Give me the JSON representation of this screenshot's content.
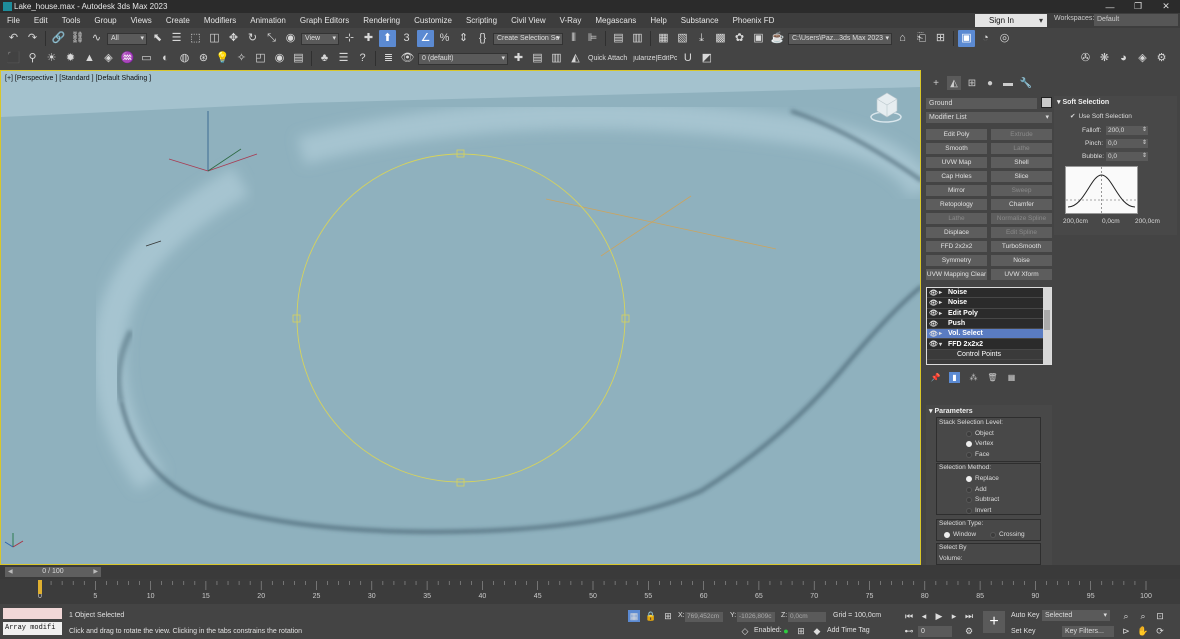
{
  "window": {
    "title": "Lake_house.max - Autodesk 3ds Max 2023",
    "controls": [
      "—",
      "❐",
      "✕"
    ]
  },
  "menubar": {
    "items": [
      "File",
      "Edit",
      "Tools",
      "Group",
      "Views",
      "Create",
      "Modifiers",
      "Animation",
      "Graph Editors",
      "Rendering",
      "Customize",
      "Scripting",
      "Civil View",
      "V-Ray",
      "Megascans",
      "Help",
      "Substance",
      "Phoenix FD"
    ],
    "sign_in": "Sign In",
    "workspaces_label": "Workspaces:",
    "workspaces_value": "Default"
  },
  "toolbar1": {
    "filter": "All",
    "ref_coord": "View",
    "selection_set": "Create Selection Se",
    "project_path": "C:\\Users\\Paz...3ds Max 2023"
  },
  "toolbar2": {
    "layer": "0 (default)",
    "quick_attach": "Quick Attach",
    "regularize": "jularize|EditPo"
  },
  "viewport": {
    "label": "[+] [Perspective ] [Standard ] [Default Shading ]",
    "ground_color": "#8fb1be",
    "gizmo_color": "#d6d35c"
  },
  "command_panel": {
    "object_name": "Ground",
    "modifier_list": "Modifier List",
    "modifier_buttons": [
      {
        "label": "Edit Poly",
        "enabled": true
      },
      {
        "label": "Extrude",
        "enabled": false
      },
      {
        "label": "Smooth",
        "enabled": true
      },
      {
        "label": "Lathe",
        "enabled": false
      },
      {
        "label": "UVW Map",
        "enabled": true
      },
      {
        "label": "Shell",
        "enabled": true
      },
      {
        "label": "Cap Holes",
        "enabled": true
      },
      {
        "label": "Slice",
        "enabled": true
      },
      {
        "label": "Mirror",
        "enabled": true
      },
      {
        "label": "Sweep",
        "enabled": false
      },
      {
        "label": "Retopology",
        "enabled": true
      },
      {
        "label": "Chamfer",
        "enabled": true
      },
      {
        "label": "Lathe",
        "enabled": false
      },
      {
        "label": "Normalize Spline",
        "enabled": false
      },
      {
        "label": "Displace",
        "enabled": true
      },
      {
        "label": "Edit Spline",
        "enabled": false
      },
      {
        "label": "FFD 2x2x2",
        "enabled": true
      },
      {
        "label": "TurboSmooth",
        "enabled": true
      },
      {
        "label": "Symmetry",
        "enabled": true
      },
      {
        "label": "Noise",
        "enabled": true
      },
      {
        "label": "UVW Mapping Clear",
        "enabled": true
      },
      {
        "label": "UVW Xform",
        "enabled": true
      }
    ],
    "stack": [
      {
        "label": "Noise",
        "selected": false
      },
      {
        "label": "Noise",
        "selected": false
      },
      {
        "label": "Edit Poly",
        "selected": false
      },
      {
        "label": "Push",
        "selected": false
      },
      {
        "label": "Vol. Select",
        "selected": true
      },
      {
        "label": "FFD 2x2x2",
        "selected": false,
        "expanded": true
      }
    ],
    "stack_sub": "Control Points",
    "parameters": {
      "title": "Parameters",
      "stack_level_label": "Stack Selection Level:",
      "stack_levels": [
        "Object",
        "Vertex",
        "Face"
      ],
      "stack_level_selected": "Vertex",
      "method_label": "Selection Method:",
      "methods": [
        "Replace",
        "Add",
        "Subtract",
        "Invert"
      ],
      "method_selected": "Replace",
      "type_label": "Selection Type:",
      "types": [
        "Window",
        "Crossing"
      ],
      "type_selected": "Window",
      "select_by_label": "Select By",
      "volume_label": "Volume:"
    },
    "soft_selection": {
      "title": "Soft Selection",
      "use_label": "Use Soft Selection",
      "use_checked": true,
      "falloff_label": "Falloff:",
      "falloff": "200,0",
      "pinch_label": "Pinch:",
      "pinch": "0,0",
      "bubble_label": "Bubble:",
      "bubble": "0,0",
      "curve_left": "200,0cm",
      "curve_mid": "0,0cm",
      "curve_right": "200,0cm"
    }
  },
  "timeline": {
    "frame": "0 / 100",
    "ticks": [
      "0",
      "5",
      "10",
      "15",
      "20",
      "25",
      "30",
      "35",
      "40",
      "45",
      "50",
      "55",
      "60",
      "65",
      "70",
      "75",
      "80",
      "85",
      "90",
      "95",
      "100"
    ]
  },
  "status": {
    "maxscript": "Array modifi",
    "selected_count": "1 Object Selected",
    "prompt": "Click and drag to rotate the view.  Clicking in the tabs constrains the rotation",
    "x_label": "X:",
    "x_value": "769,452cm",
    "y_label": "Y:",
    "y_value": "-1026,809c",
    "z_label": "Z:",
    "z_value": "0,0cm",
    "grid": "Grid = 100,0cm",
    "enabled_label": "Enabled:",
    "add_time_tag": "Add Time Tag",
    "auto_key": "Auto Key",
    "set_key": "Set Key",
    "key_mode": "Selected",
    "key_filters": "Key Filters...",
    "current_frame": "0"
  }
}
